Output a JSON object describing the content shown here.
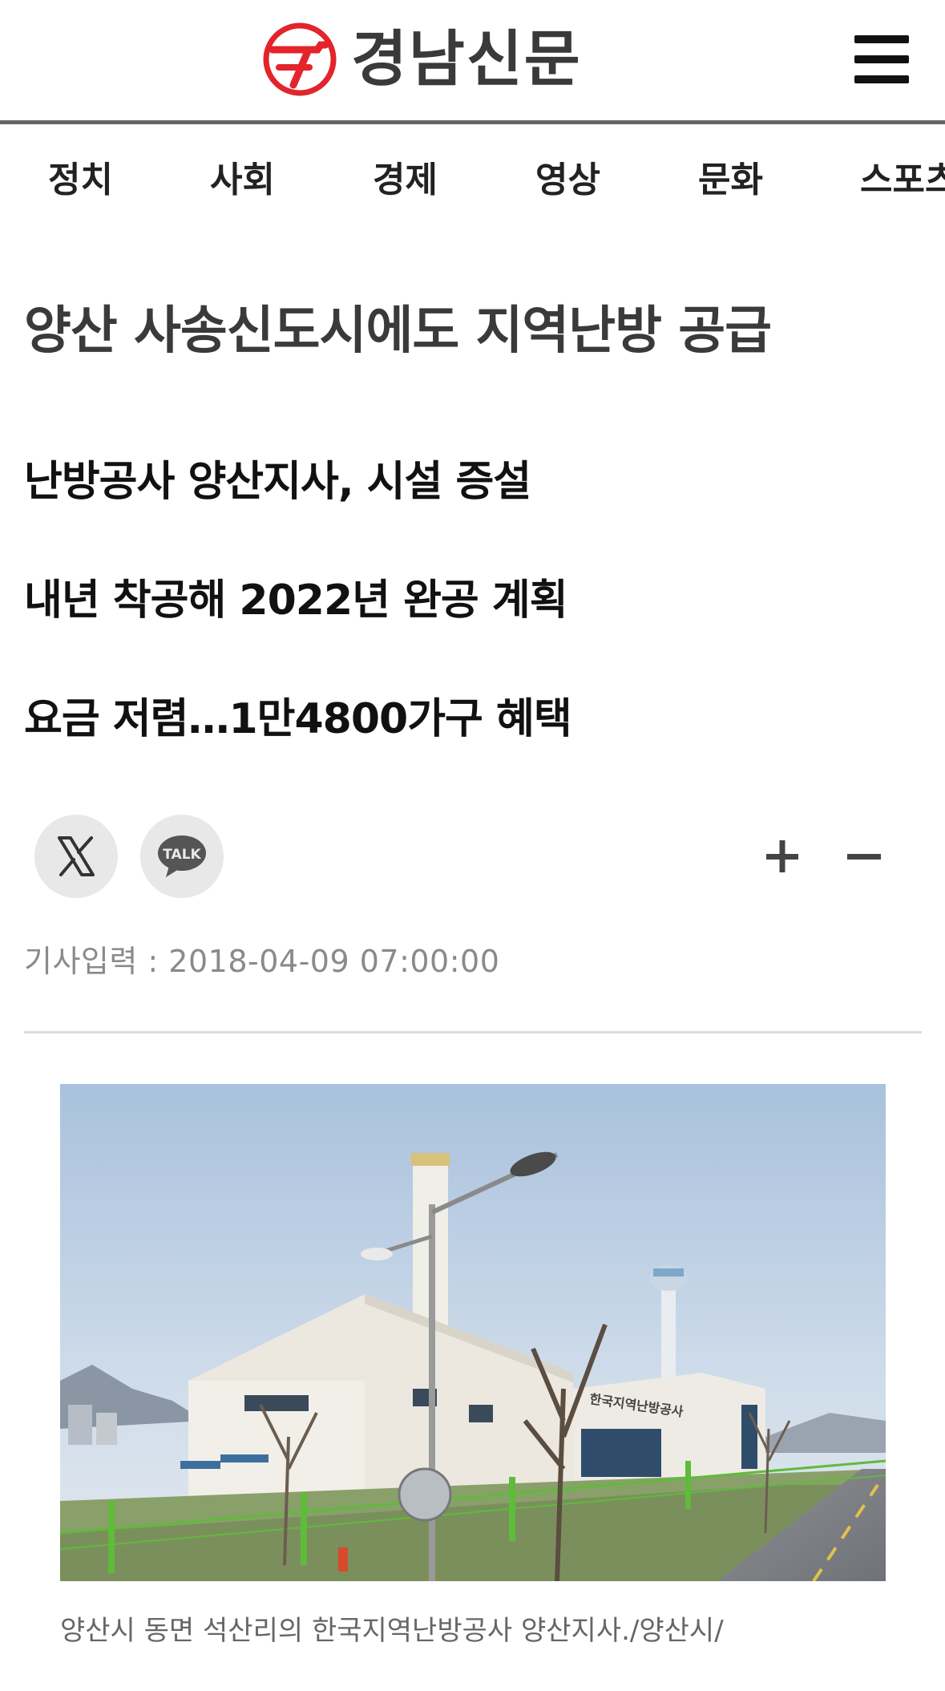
{
  "header": {
    "logo_text": "경남신문",
    "menu_icon": "hamburger-menu-icon"
  },
  "nav": {
    "items": [
      "정치",
      "사회",
      "경제",
      "영상",
      "문화",
      "스포츠"
    ]
  },
  "article": {
    "headline": "양산 사송신도시에도 지역난방 공급",
    "subheads": [
      "난방공사 양산지사, 시설 증설",
      "내년 착공해 2022년 완공 계획",
      "요금 저렴…1만4800가구 혜택"
    ],
    "date": "기사입력 : 2018-04-09 07:00:00",
    "photo_caption": "양산시 동면 석산리의 한국지역난방공사 양산지사./양산시/",
    "photo_sign_text": "한국지역난방공사"
  },
  "share": {
    "x_icon": "x-twitter-icon",
    "kakao_label": "TALK",
    "kakao_icon": "kakaotalk-icon"
  },
  "font_controls": {
    "increase_icon": "plus-icon",
    "decrease_icon": "minus-icon"
  },
  "colors": {
    "brand_red": "#e3242b",
    "header_rule": "#666666",
    "headline": "#3a3a3a"
  }
}
